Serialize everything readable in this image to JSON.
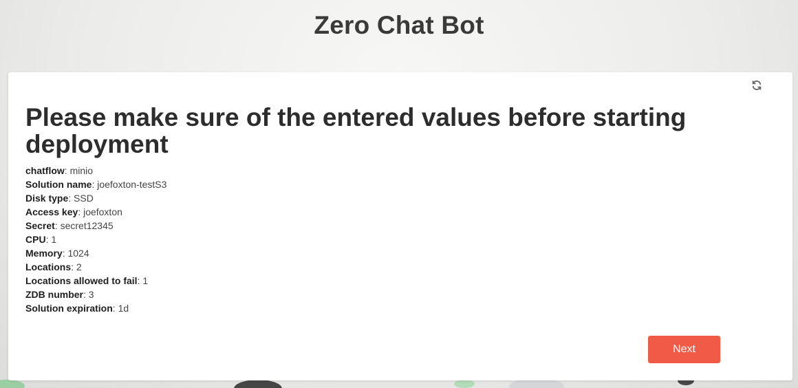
{
  "app": {
    "title": "Zero Chat Bot"
  },
  "card": {
    "heading": "Please make sure of the entered values before starting deployment",
    "refresh_icon": "refresh-icon",
    "values": [
      {
        "label": "chatflow",
        "value": "minio"
      },
      {
        "label": "Solution name",
        "value": "joefoxton-testS3"
      },
      {
        "label": "Disk type",
        "value": "SSD"
      },
      {
        "label": "Access key",
        "value": "joefoxton"
      },
      {
        "label": "Secret",
        "value": "secret12345"
      },
      {
        "label": "CPU",
        "value": "1"
      },
      {
        "label": "Memory",
        "value": "1024"
      },
      {
        "label": "Locations",
        "value": "2"
      },
      {
        "label": "Locations allowed to fail",
        "value": "1"
      },
      {
        "label": "ZDB number",
        "value": "3"
      },
      {
        "label": "Solution expiration",
        "value": "1d"
      }
    ],
    "next_label": "Next"
  },
  "colors": {
    "accent": "#f05b47",
    "card_bg": "#ffffff",
    "title_text": "#3a3a3a"
  }
}
